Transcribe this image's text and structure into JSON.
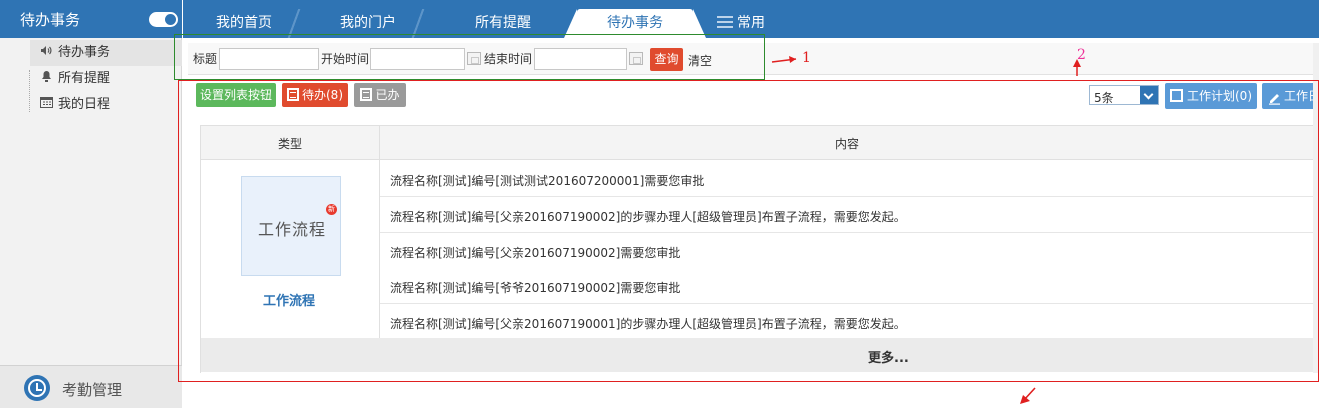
{
  "sidebar": {
    "title": "待办事务",
    "items": [
      {
        "label": "待办事务",
        "icon": "speaker-icon"
      },
      {
        "label": "所有提醒",
        "icon": "bell-icon"
      },
      {
        "label": "我的日程",
        "icon": "calendar-icon"
      }
    ],
    "footer_label": "考勤管理"
  },
  "tabs": [
    {
      "label": "我的首页"
    },
    {
      "label": "我的门户"
    },
    {
      "label": "所有提醒"
    },
    {
      "label": "待办事务",
      "active": true
    },
    {
      "label": "常用"
    }
  ],
  "search": {
    "title_label": "标题",
    "title_value": "",
    "start_label": "开始时间",
    "start_value": "",
    "end_label": "结束时间",
    "end_value": "",
    "query_button": "查询",
    "clear_link": "清空"
  },
  "toolbar": {
    "set_buttons": "设置列表按钮",
    "todo_button": "待办(8)",
    "done_button": "已办",
    "page_size": "5条",
    "work_plan_button": "工作计划(0)",
    "work_log_button": "工作日"
  },
  "annotations": {
    "label_1": "1",
    "label_2": "2",
    "green_color": "#2e8b2e",
    "red_color": "#e02020"
  },
  "table": {
    "headers": [
      "类型",
      "内容"
    ],
    "category": {
      "thumb_text": "工作流程",
      "badge": "新",
      "label": "工作流程"
    },
    "rows": [
      "流程名称[测试]编号[测试测试201607200001]需要您审批",
      "流程名称[测试]编号[父亲201607190002]的步骤办理人[超级管理员]布置子流程，需要您发起。",
      "流程名称[测试]编号[父亲201607190002]需要您审批",
      "流程名称[测试]编号[爷爷201607190002]需要您审批",
      "流程名称[测试]编号[父亲201607190001]的步骤办理人[超级管理员]布置子流程，需要您发起。"
    ],
    "more": "更多..."
  },
  "colors": {
    "brand": "#2f74b4",
    "danger": "#e04b2e",
    "success": "#5cb85c",
    "muted": "#9a9a9a",
    "info": "#5a9ad7"
  }
}
